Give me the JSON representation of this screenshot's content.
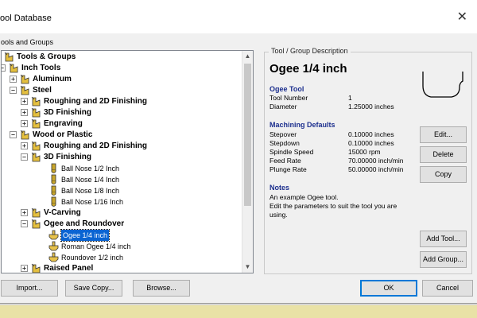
{
  "window": {
    "title": "ool Database",
    "close_glyph": "✕"
  },
  "tree_panel": {
    "label": "ools and Groups",
    "rows": [
      {
        "text": "Tools & Groups",
        "bold": true,
        "icon": "tool-group-icon"
      },
      {
        "text": "Inch Tools",
        "bold": true,
        "icon": "tool-group-icon",
        "expander": "-"
      },
      {
        "text": "Aluminum",
        "bold": true,
        "icon": "tool-group-icon",
        "expander": "+"
      },
      {
        "text": "Steel",
        "bold": true,
        "icon": "tool-group-icon",
        "expander": "-"
      },
      {
        "text": "Roughing and 2D Finishing",
        "bold": true,
        "icon": "tool-group-icon",
        "expander": "+"
      },
      {
        "text": "3D Finishing",
        "bold": true,
        "icon": "tool-group-icon",
        "expander": "+"
      },
      {
        "text": "Engraving",
        "bold": true,
        "icon": "tool-group-icon",
        "expander": "+"
      },
      {
        "text": "Wood or Plastic",
        "bold": true,
        "icon": "tool-group-icon",
        "expander": "-"
      },
      {
        "text": "Roughing and 2D Finishing",
        "bold": true,
        "icon": "tool-group-icon",
        "expander": "+"
      },
      {
        "text": "3D Finishing",
        "bold": true,
        "icon": "tool-group-icon",
        "expander": "-"
      },
      {
        "text": "Ball Nose 1/2 Inch",
        "bold": false,
        "icon": "ball-nose-icon"
      },
      {
        "text": "Ball Nose 1/4 Inch",
        "bold": false,
        "icon": "ball-nose-icon"
      },
      {
        "text": "Ball Nose 1/8 Inch",
        "bold": false,
        "icon": "ball-nose-icon"
      },
      {
        "text": "Ball Nose 1/16 Inch",
        "bold": false,
        "icon": "ball-nose-icon"
      },
      {
        "text": "V-Carving",
        "bold": true,
        "icon": "tool-group-icon",
        "expander": "+"
      },
      {
        "text": "Ogee and Roundover",
        "bold": true,
        "icon": "tool-group-icon",
        "expander": "-"
      },
      {
        "text": "Ogee 1/4 inch",
        "bold": false,
        "icon": "form-tool-icon",
        "selected": true
      },
      {
        "text": "Roman Ogee 1/4 inch",
        "bold": false,
        "icon": "form-tool-icon"
      },
      {
        "text": "Roundover 1/2 inch",
        "bold": false,
        "icon": "form-tool-icon"
      },
      {
        "text": "Raised Panel",
        "bold": true,
        "icon": "tool-group-icon",
        "expander": "+"
      }
    ]
  },
  "description": {
    "legend": "Tool / Group Description",
    "tool_name": "Ogee 1/4 inch",
    "tool_section": {
      "heading": "Ogee Tool",
      "rows": [
        {
          "label": "Tool Number",
          "value": "1"
        },
        {
          "label": "Diameter",
          "value": "1.25000 inches"
        }
      ]
    },
    "machining_section": {
      "heading": "Machining Defaults",
      "rows": [
        {
          "label": "Stepover",
          "value": "0.10000 inches"
        },
        {
          "label": "Stepdown",
          "value": "0.10000 inches"
        },
        {
          "label": "Spindle Speed",
          "value": "15000 rpm"
        },
        {
          "label": "Feed Rate",
          "value": "70.00000 inch/min"
        },
        {
          "label": "Plunge Rate",
          "value": "50.00000 inch/min"
        }
      ]
    },
    "notes_section": {
      "heading": "Notes",
      "lines": [
        "An example Ogee tool.",
        "Edit the parameters to suit the tool you are",
        "using."
      ]
    }
  },
  "buttons": {
    "edit": "Edit...",
    "delete": "Delete",
    "copy": "Copy",
    "add_tool": "Add Tool...",
    "add_group": "Add Group...",
    "import": "Import...",
    "save_copy": "Save Copy...",
    "browse": "Browse...",
    "ok": "OK",
    "cancel": "Cancel"
  },
  "colors": {
    "selection": "#0a64d2",
    "section_heading": "#1c2f8e",
    "default_button_border": "#0078d7"
  }
}
